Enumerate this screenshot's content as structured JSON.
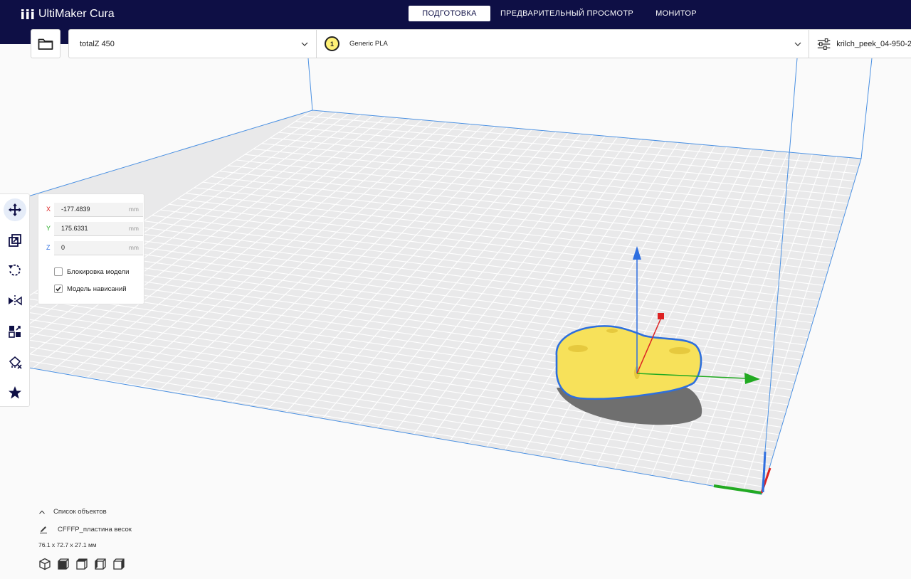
{
  "app": {
    "name": "UltiMaker Cura"
  },
  "stages": [
    {
      "label": "ПОДГОТОВКА",
      "active": true
    },
    {
      "label": "ПРЕДВАРИТЕЛЬНЫЙ ПРОСМОТР",
      "active": false
    },
    {
      "label": "МОНИТОР",
      "active": false
    }
  ],
  "config": {
    "printer": "totalZ 450",
    "extruder_number": "1",
    "material": "Generic PLA",
    "profile": "krilch_peek_04-950-2"
  },
  "move_panel": {
    "x": {
      "axis": "X",
      "value": "-177.4839",
      "unit": "mm"
    },
    "y": {
      "axis": "Y",
      "value": "175.6331",
      "unit": "mm"
    },
    "z": {
      "axis": "Z",
      "value": "0",
      "unit": "mm"
    },
    "lock_model": {
      "label": "Блокировка модели",
      "checked": false
    },
    "drop_down": {
      "label": "Модель нависаний",
      "checked": true
    }
  },
  "tools": [
    "move-icon",
    "scale-icon",
    "rotate-icon",
    "mirror-icon",
    "per-model-settings-icon",
    "support-blocker-icon",
    "custom-support-icon"
  ],
  "object_list": {
    "toggle_label": "Список объектов",
    "object_name": "CFFFP_пластина весок",
    "dimensions": "76.1 x 72.7 x 27.1 мм"
  },
  "colors": {
    "header": "#0e0f45",
    "build_volume": "#4a90e2",
    "model": "#f7e15a",
    "model_outline": "#2e6fdd",
    "axis_x": "#d22",
    "axis_y": "#2a2",
    "axis_z": "#2f6fe0"
  }
}
